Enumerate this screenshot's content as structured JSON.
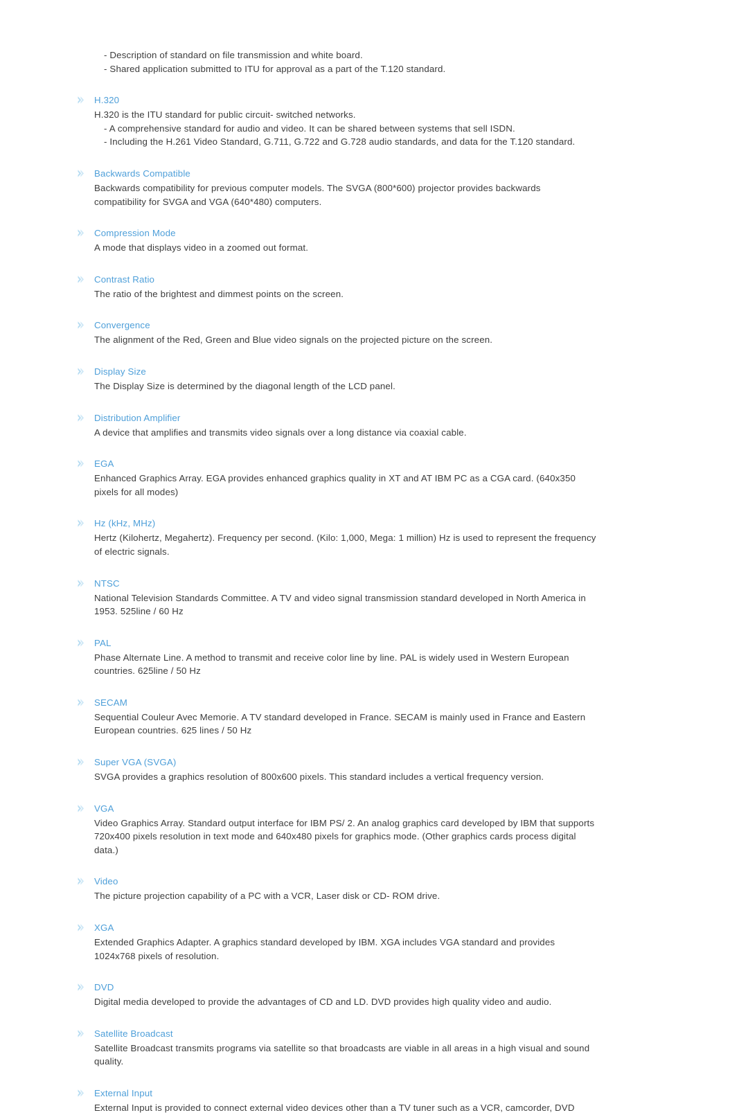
{
  "document": {
    "background_color": "#ffffff",
    "term_color": "#4e9fd9",
    "body_color": "#3c3c3c",
    "bullet_icon": "double-chevron-right-icon"
  },
  "intro_list": [
    "-  Description of standard on file transmission and white board.",
    "-  Shared application submitted to ITU for approval as a part of the T.120 standard."
  ],
  "sections": [
    {
      "term": "H.320",
      "lead": "H.320 is the ITU standard for public circuit- switched networks.",
      "bullets": [
        "-  A comprehensive standard for audio and video. It can be shared between systems that sell ISDN.",
        "-  Including the H.261 Video Standard, G.711, G.722 and G.728 audio standards, and data for the T.120 standard."
      ]
    },
    {
      "term": "Backwards Compatible",
      "lines": [
        "Backwards compatibility for previous computer models. The SVGA (800*600) projector provides backwards",
        "compatibility for SVGA and VGA (640*480) computers."
      ]
    },
    {
      "term": "Compression Mode",
      "lines": [
        "A mode that displays video in a zoomed out format."
      ]
    },
    {
      "term": "Contrast Ratio",
      "lines": [
        "The ratio of the brightest and dimmest points on the screen."
      ]
    },
    {
      "term": "Convergence",
      "lines": [
        "The alignment of the Red, Green and Blue video signals on the projected picture on the screen."
      ]
    },
    {
      "term": "Display Size",
      "lines": [
        "The Display Size is determined by the diagonal length of the LCD panel."
      ]
    },
    {
      "term": "Distribution Amplifier",
      "lines": [
        "A device that amplifies and transmits video signals over a long distance via coaxial cable."
      ]
    },
    {
      "term": "EGA",
      "lines": [
        "Enhanced Graphics Array. EGA provides enhanced graphics quality in XT and AT IBM PC as a CGA card. (640x350",
        "pixels for all modes)"
      ]
    },
    {
      "term": "Hz (kHz, MHz)",
      "lines": [
        "Hertz (Kilohertz, Megahertz). Frequency per second. (Kilo: 1,000, Mega: 1 million) Hz is used to represent the frequency",
        "of electric signals."
      ]
    },
    {
      "term": "NTSC",
      "lines": [
        "National Television Standards Committee. A TV and video signal transmission standard developed in North America in",
        "1953. 525line / 60 Hz"
      ]
    },
    {
      "term": "PAL",
      "lines": [
        "Phase Alternate Line. A method to transmit and receive color line by line. PAL is widely used in Western European",
        "countries. 625line / 50 Hz"
      ]
    },
    {
      "term": "SECAM",
      "lines": [
        "Sequential Couleur Avec Memorie. A TV standard developed in France. SECAM is mainly used in France and Eastern",
        "European countries. 625 lines / 50 Hz"
      ]
    },
    {
      "term": "Super VGA (SVGA)",
      "lines": [
        "SVGA provides a graphics resolution of 800x600 pixels. This standard includes a vertical frequency version."
      ]
    },
    {
      "term": "VGA",
      "lines": [
        "Video Graphics Array. Standard output interface for IBM PS/ 2. An analog graphics card developed by IBM that supports",
        "720x400 pixels resolution in text mode and 640x480 pixels for graphics mode. (Other graphics cards process digital",
        "data.)"
      ]
    },
    {
      "term": "Video",
      "lines": [
        "The picture projection capability of a PC with a VCR, Laser disk or CD- ROM drive."
      ]
    },
    {
      "term": "XGA",
      "lines": [
        "Extended Graphics Adapter. A graphics standard developed by IBM. XGA includes VGA standard and provides",
        "1024x768 pixels of resolution."
      ]
    },
    {
      "term": "DVD",
      "lines": [
        "Digital media developed to provide the advantages of CD and LD. DVD provides high quality video and audio."
      ]
    },
    {
      "term": "Satellite Broadcast",
      "lines": [
        "Satellite Broadcast transmits programs via satellite so that broadcasts are viable in all areas in a high visual and sound",
        "quality."
      ]
    },
    {
      "term": "External Input",
      "lines": [
        "External Input is provided to connect external video devices other than a TV tuner such as a VCR, camcorder, DVD"
      ]
    }
  ]
}
